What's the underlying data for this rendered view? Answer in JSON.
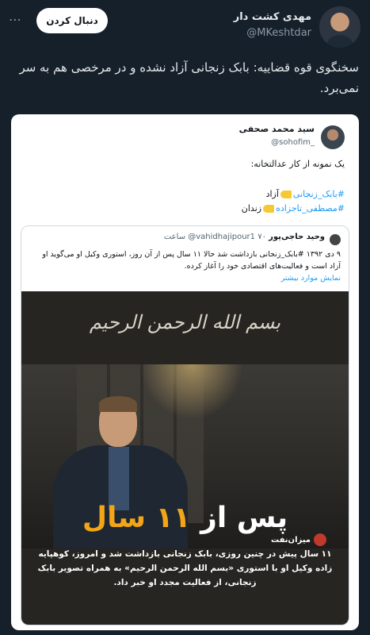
{
  "tweet": {
    "author_name": "مهدی کشت دار",
    "author_handle": "@MKeshtdar",
    "follow_label": "دنبال کردن",
    "more_icon": "ellipsis-icon",
    "text": "سخنگوی قوه قضاییه: بابک زنجانی آزاد نشده و در مرخصی هم به سر نمی‌برد."
  },
  "embedded_tweet": {
    "author_name": "سید محمد صحفی",
    "author_handle": "@sohofim_",
    "text": "یک نمونه از کار عدالتخانه:",
    "lines": [
      {
        "tag": "#بابک_زنجانی",
        "suffix": "آزاد"
      },
      {
        "tag": "#مصطفی_تاجزاده",
        "suffix": "زندان"
      }
    ]
  },
  "quoted_tweet": {
    "author_name": "وحید حاجی‌پور",
    "author_handle": "@vahidhajipour1",
    "time": "۷۰ ساعت",
    "body": "۹ دی ۱۳۹۲ #بابک_زنجانی بازداشت شد حالا ۱۱ سال پس از آن روز، استوری وکیل او می‌گوید او آزاد است و فعالیت‌های اقتصادی خود را آغاز کرده.",
    "show_more": "نمایش موارد بیشتر"
  },
  "image": {
    "bismillah": "بسم الله الرحمن الرحیم",
    "logo_text": "میزان‌نفت",
    "headline_prefix": "پس از",
    "headline_accent": "۱۱ سال",
    "caption": "۱۱ سال پیش در چنین روزی، بابک زنجانی بازداشت شد و امروز، کوهپایه زاده وکیل او با استوری «بسم الله الرحمن الرحیم» به همراه تصویر بابک زنجانی، از فعالیت مجدد او خبر داد."
  },
  "colors": {
    "background": "#15202b",
    "link": "#1d9bf0",
    "accent": "#f2a516"
  }
}
